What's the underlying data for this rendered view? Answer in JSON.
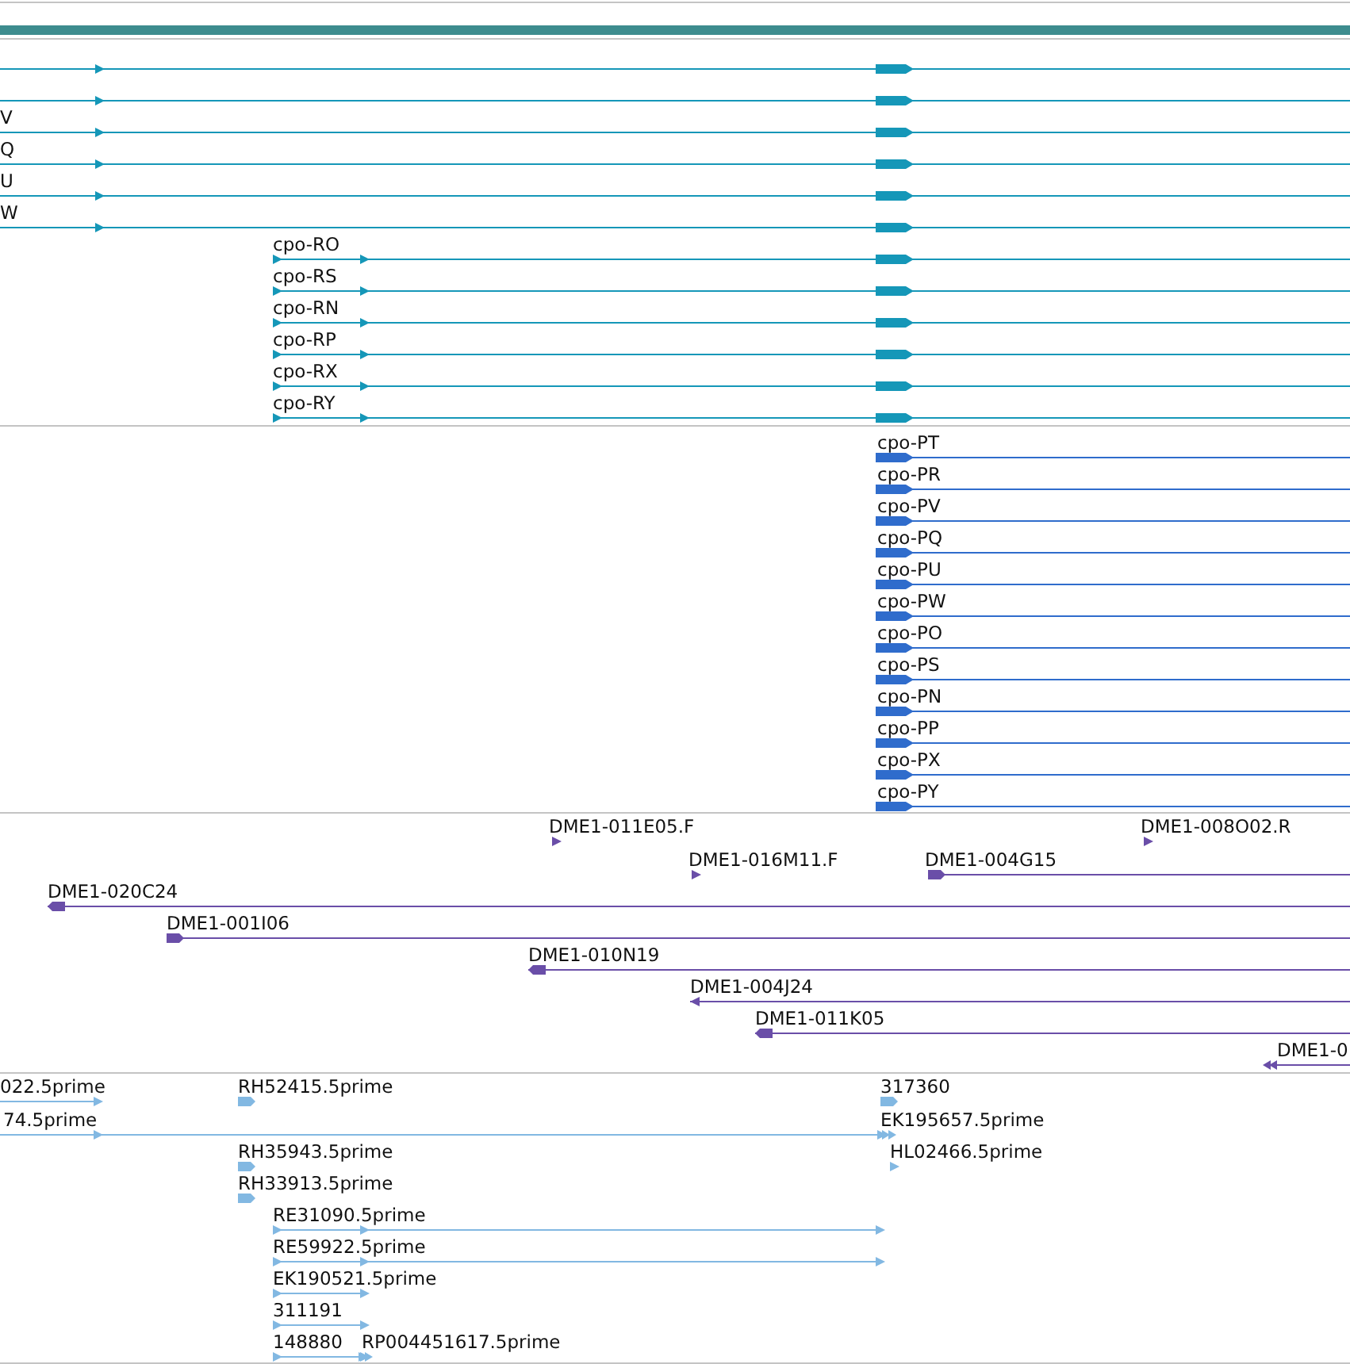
{
  "tracks": [
    {
      "features": [
        {
          "reverse": false
        },
        {
          "reverse": false
        },
        {
          "label": "V",
          "reverse": false
        },
        {
          "label": "Q",
          "reverse": false
        },
        {
          "label": "U",
          "reverse": false
        },
        {
          "label": "W",
          "reverse": false
        },
        {
          "label": "cpo-RO",
          "reverse": false
        },
        {
          "label": "cpo-RS",
          "reverse": false
        },
        {
          "label": "cpo-RN",
          "reverse": false
        },
        {
          "label": "cpo-RP",
          "reverse": false
        },
        {
          "label": "cpo-RX",
          "reverse": false
        },
        {
          "label": "cpo-RY",
          "reverse": false
        }
      ]
    },
    {
      "features": [
        {
          "label": "cpo-PT",
          "reverse": false
        },
        {
          "label": "cpo-PR",
          "reverse": false
        },
        {
          "label": "cpo-PV",
          "reverse": false
        },
        {
          "label": "cpo-PQ",
          "reverse": false
        },
        {
          "label": "cpo-PU",
          "reverse": false
        },
        {
          "label": "cpo-PW",
          "reverse": false
        },
        {
          "label": "cpo-PO",
          "reverse": false
        },
        {
          "label": "cpo-PS",
          "reverse": false
        },
        {
          "label": "cpo-PN",
          "reverse": false
        },
        {
          "label": "cpo-PP",
          "reverse": false
        },
        {
          "label": "cpo-PX",
          "reverse": false
        },
        {
          "label": "cpo-PY",
          "reverse": false
        }
      ]
    },
    {
      "features": [
        {
          "label": "DME1-011E05.F",
          "reverse": false
        },
        {
          "label": "DME1-008O02.R",
          "reverse": false
        },
        {
          "label": "DME1-016M11.F",
          "reverse": false
        },
        {
          "label": "DME1-004G15",
          "reverse": false
        },
        {
          "label": "DME1-020C24",
          "reverse": true
        },
        {
          "label": "DME1-001I06",
          "reverse": false
        },
        {
          "label": "DME1-010N19",
          "reverse": true
        },
        {
          "label": "DME1-004J24",
          "reverse": true
        },
        {
          "label": "DME1-011K05",
          "reverse": true
        },
        {
          "label": "DME1-0",
          "reverse": true
        }
      ]
    },
    {
      "features": [
        {
          "label": "022.5prime",
          "reverse": false
        },
        {
          "label": "74.5prime",
          "reverse": false
        },
        {
          "label": "RH52415.5prime",
          "reverse": false
        },
        {
          "label": "317360",
          "reverse": false
        },
        {
          "label": "EK195657.5prime",
          "reverse": false
        },
        {
          "label": "RH35943.5prime",
          "reverse": false
        },
        {
          "label": "HL02466.5prime",
          "reverse": false
        },
        {
          "label": "RH33913.5prime",
          "reverse": false
        },
        {
          "label": "RE31090.5prime",
          "reverse": false
        },
        {
          "label": "RE59922.5prime",
          "reverse": false
        },
        {
          "label": "EK190521.5prime",
          "reverse": false
        },
        {
          "label": "311191",
          "reverse": false
        },
        {
          "label": "148880",
          "reverse": false
        },
        {
          "label": "RP004451617.5prime",
          "reverse": false
        }
      ]
    }
  ]
}
